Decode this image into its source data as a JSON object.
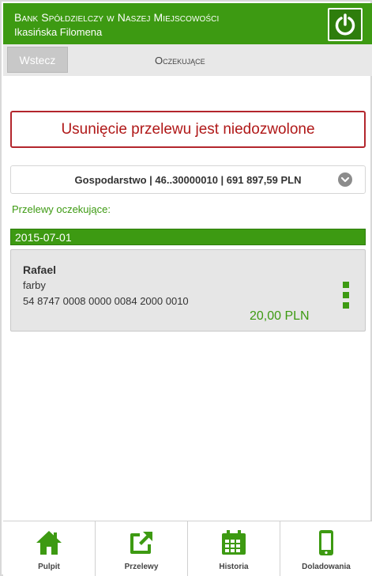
{
  "header": {
    "bank_name": "Bank Spółdzielczy w Naszej Miejscowości",
    "user_name": "Ikasińska Filomena"
  },
  "subbar": {
    "back_label": "Wstecz",
    "title": "Oczekujące"
  },
  "alert": {
    "message": "Usunięcie przelewu jest niedozwolone"
  },
  "account": {
    "selected": "Gospodarstwo | 46..30000010 | 691 897,59 PLN"
  },
  "section_label": "Przelewy oczekujące:",
  "groups": [
    {
      "date": "2015-07-01",
      "transfers": [
        {
          "recipient": "Rafael",
          "description": "farby",
          "account_number": "54 8747 0008 0000 0084 2000 0010",
          "amount": "20,00 PLN"
        }
      ]
    }
  ],
  "nav": [
    {
      "label": "Pulpit",
      "icon": "home-icon"
    },
    {
      "label": "Przelewy",
      "icon": "external-link-icon"
    },
    {
      "label": "Historia",
      "icon": "calendar-icon"
    },
    {
      "label": "Doladowania",
      "icon": "mobile-phone-icon"
    }
  ],
  "colors": {
    "brand_green": "#3d9a12",
    "alert_red": "#b01818",
    "panel_gray": "#e6e6e6"
  }
}
